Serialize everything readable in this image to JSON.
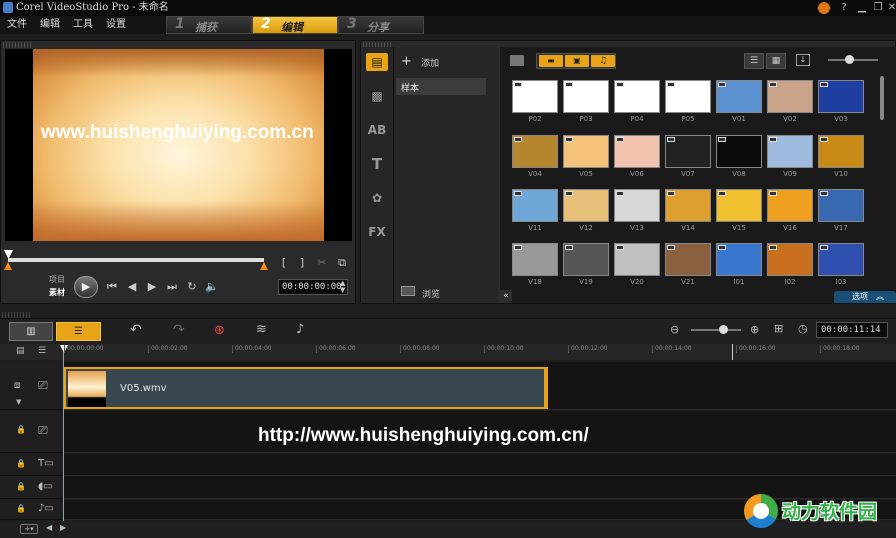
{
  "window": {
    "title": "Corel VideoStudio Pro - 未命名"
  },
  "menu": [
    "文件",
    "编辑",
    "工具",
    "设置"
  ],
  "steps": [
    {
      "num": "1",
      "label": "捕获",
      "active": false
    },
    {
      "num": "2",
      "label": "编辑",
      "active": true
    },
    {
      "num": "3",
      "label": "分享",
      "active": false
    }
  ],
  "player": {
    "watermark": "www.huishenghuiying.com.cn",
    "mode_project": "项目",
    "mode_clip": "素材",
    "timecode": "00:00:00:00"
  },
  "library": {
    "add_label": "添加",
    "folder": "样本",
    "browse_label": "浏览",
    "options_label": "选项",
    "thumbs": [
      {
        "name": "P02",
        "color": "#ffffff"
      },
      {
        "name": "P03",
        "color": "#ffffff"
      },
      {
        "name": "P04",
        "color": "#ffffff"
      },
      {
        "name": "P05",
        "color": "#ffffff"
      },
      {
        "name": "V01",
        "color": "#5a8fd0"
      },
      {
        "name": "V02",
        "color": "#c9a48a"
      },
      {
        "name": "V03",
        "color": "#1e3fa0"
      },
      {
        "name": "V04",
        "color": "#b4862e"
      },
      {
        "name": "V05",
        "color": "#f4c27a"
      },
      {
        "name": "V06",
        "color": "#f2c4b0"
      },
      {
        "name": "V07",
        "color": "#222222"
      },
      {
        "name": "V08",
        "color": "#0b0b0b"
      },
      {
        "name": "V09",
        "color": "#9fbbe0"
      },
      {
        "name": "V10",
        "color": "#c98a15"
      },
      {
        "name": "V11",
        "color": "#6fa8d8"
      },
      {
        "name": "V12",
        "color": "#e8c07a"
      },
      {
        "name": "V13",
        "color": "#d8d8d8"
      },
      {
        "name": "V14",
        "color": "#e0a030"
      },
      {
        "name": "V15",
        "color": "#f0c030"
      },
      {
        "name": "V16",
        "color": "#f0a020"
      },
      {
        "name": "V17",
        "color": "#3868b0"
      },
      {
        "name": "V18",
        "color": "#999999"
      },
      {
        "name": "V19",
        "color": "#555555"
      },
      {
        "name": "V20",
        "color": "#c0c0c0"
      },
      {
        "name": "V21",
        "color": "#8a6040"
      },
      {
        "name": "I01",
        "color": "#3a78d0"
      },
      {
        "name": "I02",
        "color": "#c87020"
      },
      {
        "name": "I03",
        "color": "#3050b0"
      }
    ]
  },
  "timeline": {
    "timecode": "00:00:11:14",
    "ruler": [
      "00:00:00:00",
      "00:00:02:00",
      "00:00:04:00",
      "00:00:06:00",
      "00:00:08:00",
      "00:00:10:00",
      "00:00:12:00",
      "00:00:14:00",
      "00:00:16:00",
      "00:00:18:00"
    ],
    "clip_name": "V05.wmv"
  },
  "overlay": {
    "url": "http://www.huishenghuiying.com.cn/",
    "logo_text": "动力软件园"
  },
  "colors": {
    "accent": "#e8a317",
    "options_tab": "#1a4f78"
  }
}
